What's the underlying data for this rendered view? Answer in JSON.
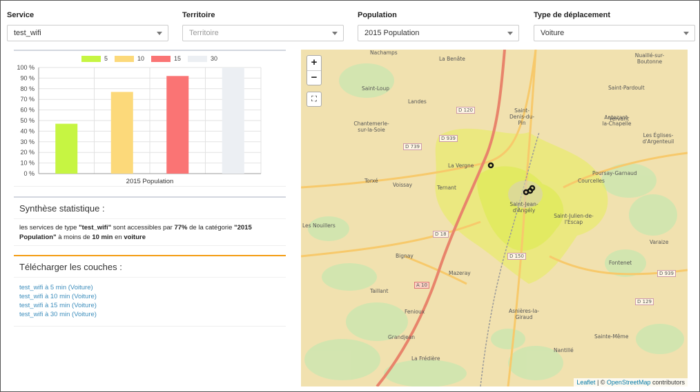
{
  "filters": [
    {
      "label": "Service",
      "value": "test_wifi",
      "disabled": false
    },
    {
      "label": "Territoire",
      "value": "Territoire",
      "disabled": true
    },
    {
      "label": "Population",
      "value": "2015 Population",
      "disabled": false
    },
    {
      "label": "Type de déplacement",
      "value": "Voiture",
      "disabled": false
    }
  ],
  "chart_data": {
    "type": "bar",
    "categories": [
      "2015 Population"
    ],
    "series": [
      {
        "name": "5",
        "color": "#c6f542",
        "values": [
          47
        ]
      },
      {
        "name": "10",
        "color": "#fcd97a",
        "values": [
          77
        ]
      },
      {
        "name": "15",
        "color": "#fa7474",
        "values": [
          92
        ]
      },
      {
        "name": "30",
        "color": "#eceff3",
        "values": [
          100
        ]
      }
    ],
    "ylim": [
      0,
      100
    ],
    "yticks": [
      "0 %",
      "10 %",
      "20 %",
      "30 %",
      "40 %",
      "50 %",
      "60 %",
      "70 %",
      "80 %",
      "90 %",
      "100 %"
    ],
    "grid": true,
    "legend": "top"
  },
  "stats": {
    "title": "Synthèse statistique :",
    "text_1": "les services de type ",
    "service": "\"test_wifi\"",
    "text_2": " sont accessibles par ",
    "percent": "77%",
    "text_3": " de la catégorie ",
    "category": "\"2015 Population\"",
    "text_4": " à moins de ",
    "duration": "10 min",
    "text_5": " en ",
    "mode": "voiture"
  },
  "downloads": {
    "title": "Télécharger les couches :",
    "links": [
      "test_wifi à 5 min (Voiture)",
      "test_wifi à 10 min (Voiture)",
      "test_wifi à 15 min (Voiture)",
      "test_wifi à 30 min (Voiture)"
    ]
  },
  "map": {
    "zoom_in": "+",
    "zoom_out": "−",
    "fullscreen": "⛶",
    "attribution_leaflet": "Leaflet",
    "attribution_sep": " | © ",
    "attribution_osm": "OpenStreetMap",
    "attribution_tail": " contributors",
    "places": [
      "Nachamps",
      "La Benâte",
      "Nuaillé-sur-Boutonne",
      "Saint-Loup",
      "Landes",
      "Saint-Pardoult",
      "Saint-Denis-du-Pin",
      "Antezant-la-Chapelle",
      "Chantemerle-sur-la-Soie",
      "Les Églises-d'Argenteuil",
      "Vervant",
      "La Vergne",
      "Poursay-Garnaud",
      "Courcelles",
      "Torxé",
      "Voissay",
      "Ternant",
      "Saint-Jean-d'Angély",
      "Saint-Julien-de-l'Escap",
      "Les Nouillers",
      "Varaize",
      "Bignay",
      "Fontenet",
      "Mazeray",
      "Taillant",
      "Fenioux",
      "Asnières-la-Giraud",
      "Grandjean",
      "Sainte-Même",
      "Nantillé",
      "La Frédière"
    ],
    "roads": [
      "D 120",
      "D 939",
      "D 739",
      "D 18",
      "D 150",
      "A 10",
      "D 939",
      "D 129"
    ]
  }
}
